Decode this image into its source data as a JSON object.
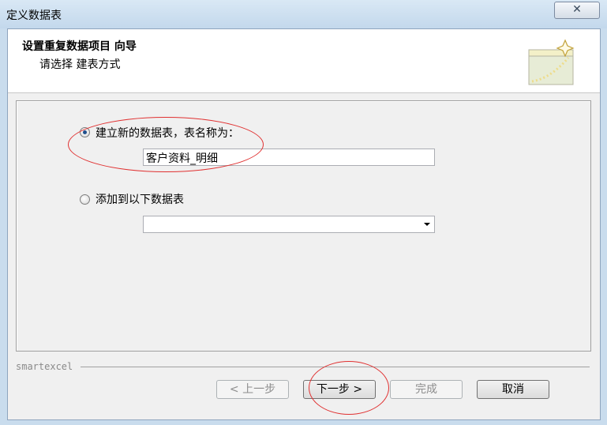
{
  "window": {
    "title": "定义数据表",
    "close_glyph": "✕"
  },
  "header": {
    "title": "设置重复数据项目 向导",
    "subtitle": "请选择 建表方式"
  },
  "options": {
    "new_table": {
      "label": "建立新的数据表，表名称为：",
      "selected": true,
      "value": "客户资料_明细"
    },
    "append": {
      "label": "添加到以下数据表",
      "selected": false,
      "value": ""
    }
  },
  "footer": {
    "brand": "smartexcel",
    "prev_label": "< 上一步",
    "next_label": "下一步 >",
    "finish_label": "完成",
    "cancel_label": "取消"
  },
  "icons": {
    "wizard": "wizard-window-sparkle-icon",
    "combo_arrow": "chevron-down-icon",
    "close": "close-icon"
  },
  "colors": {
    "annotation": "#e03030",
    "radio_selected": "#1f4f8c"
  }
}
